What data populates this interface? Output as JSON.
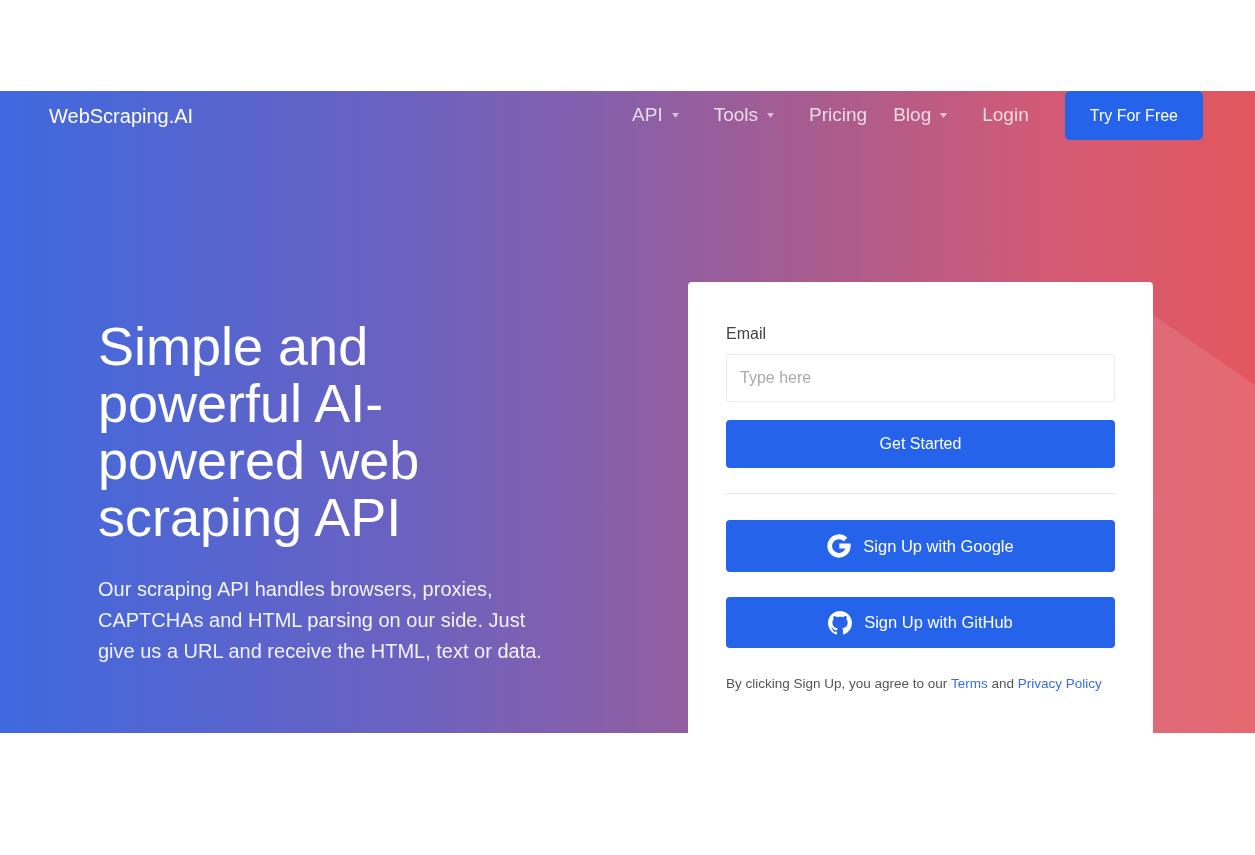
{
  "navbar": {
    "brand": "WebScraping.AI",
    "links": [
      {
        "label": "API",
        "dropdown": true
      },
      {
        "label": "Tools",
        "dropdown": true
      },
      {
        "label": "Pricing",
        "dropdown": false
      },
      {
        "label": "Blog",
        "dropdown": true
      },
      {
        "label": "Login",
        "dropdown": false
      }
    ],
    "cta_button": "Try For Free"
  },
  "hero": {
    "heading": "Simple and powerful AI-powered web scraping API",
    "description": "Our scraping API handles browsers, proxies, CAPTCHAs and HTML parsing on our side. Just give us a URL and receive the HTML, text or data."
  },
  "signup_card": {
    "email_field": {
      "label": "Email",
      "placeholder": "Type here"
    },
    "submit_button": "Get Started",
    "social_buttons": [
      {
        "kind": "google",
        "label": "Sign Up with Google"
      },
      {
        "kind": "github",
        "label": "Sign Up with GitHub"
      }
    ],
    "consent": [
      {
        "kind": "text",
        "text": "By clicking Sign Up, you agree to our"
      },
      {
        "kind": "link",
        "text": "Terms"
      },
      {
        "kind": "text",
        "text": "and"
      },
      {
        "kind": "link",
        "text": "Privacy Policy"
      }
    ]
  }
}
